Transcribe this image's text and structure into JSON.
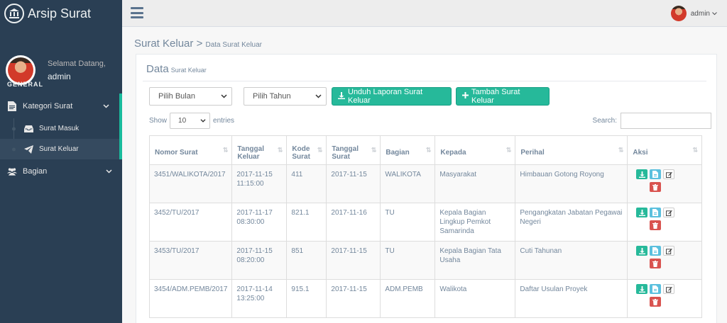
{
  "brand": {
    "title": "Arsip Surat",
    "icon": "bank-icon"
  },
  "profile": {
    "welcome": "Selamat Datang,",
    "username": "admin"
  },
  "sidebar": {
    "section": "GENERAL",
    "items": [
      {
        "label": "Kategori Surat",
        "icon": "file-icon",
        "submenu": [
          {
            "label": "Surat Masuk",
            "icon": "inbox-icon"
          },
          {
            "label": "Surat Keluar",
            "icon": "paper-plane-icon"
          }
        ]
      },
      {
        "label": "Bagian",
        "icon": "users-icon"
      }
    ]
  },
  "topnav": {
    "user": "admin"
  },
  "breadcrumb": {
    "title": "Surat Keluar",
    "separator": ">",
    "sub": "Data Surat Keluar"
  },
  "panel": {
    "title": "Data",
    "subtitle": "Surat Keluar"
  },
  "filters": {
    "month_placeholder": "Pilih Bulan",
    "year_placeholder": "Pilih Tahun",
    "download_label": "Unduh Laporan Surat Keluar",
    "add_label": "Tambah Surat Keluar"
  },
  "datatable": {
    "show": "Show",
    "entries_value": "10",
    "entries": "entries",
    "search": "Search:"
  },
  "table": {
    "headers": [
      "Nomor Surat",
      "Tanggal Keluar",
      "Kode Surat",
      "Tanggal Surat",
      "Bagian",
      "Kepada",
      "Perihal",
      "Aksi"
    ],
    "rows": [
      {
        "nomor": "3451/WALIKOTA/2017",
        "tgl_keluar": "2017-11-15 11:15:00",
        "kode": "411",
        "tgl_surat": "2017-11-15",
        "bagian": "WALIKOTA",
        "kepada": "Masyarakat",
        "perihal": "Himbauan Gotong Royong"
      },
      {
        "nomor": "3452/TU/2017",
        "tgl_keluar": "2017-11-17 08:30:00",
        "kode": "821.1",
        "tgl_surat": "2017-11-16",
        "bagian": "TU",
        "kepada": "Kepala Bagian Lingkup Pemkot Samarinda",
        "perihal": "Pengangkatan Jabatan Pegawai Negeri"
      },
      {
        "nomor": "3453/TU/2017",
        "tgl_keluar": "2017-11-15 08:20:00",
        "kode": "851",
        "tgl_surat": "2017-11-15",
        "bagian": "TU",
        "kepada": "Kepala Bagian Tata Usaha",
        "perihal": "Cuti Tahunan"
      },
      {
        "nomor": "3454/ADM.PEMB/2017",
        "tgl_keluar": "2017-11-14 13:25:00",
        "kode": "915.1",
        "tgl_surat": "2017-11-15",
        "bagian": "ADM.PEMB",
        "kepada": "Walikota",
        "perihal": "Daftar Usulan Proyek"
      }
    ]
  },
  "colors": {
    "sidebar": "#2a3f54",
    "accent": "#26b99a",
    "info": "#5bc0de",
    "danger": "#d9534f"
  }
}
